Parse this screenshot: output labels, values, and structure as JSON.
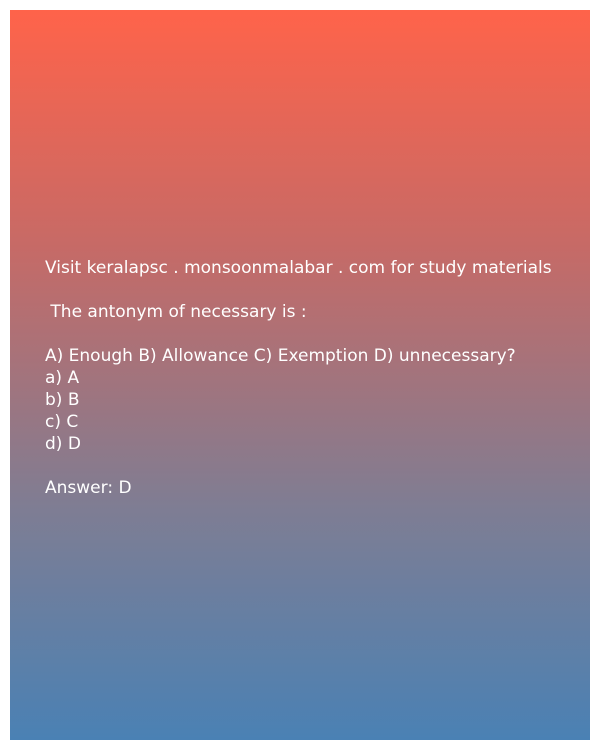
{
  "header_text": "Visit keralapsc . monsoonmalabar . com for study materials",
  "question": " The antonym of necessary is :",
  "choices_line": "A) Enough B) Allowance C) Exemption D) unnecessary?",
  "options": [
    "a) A",
    "b) B",
    "c) C",
    "d) D"
  ],
  "answer": "Answer: D"
}
